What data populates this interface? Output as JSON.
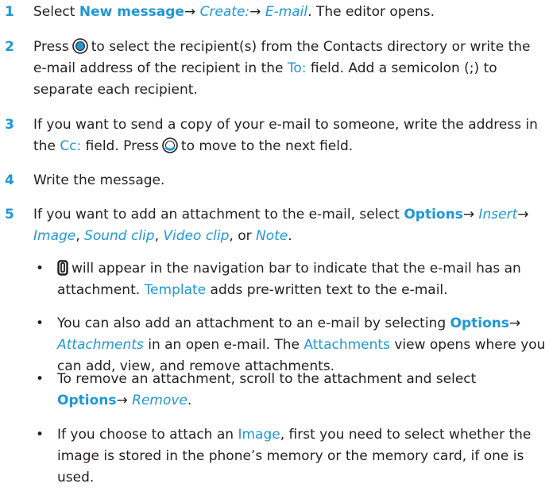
{
  "steps": [
    {
      "number": "1",
      "pre": "Select ",
      "new_message": "New message",
      "arrow1": "→ ",
      "create": "Create:",
      "arrow2": "→ ",
      "email": "E-mail",
      "post": ". The editor opens."
    },
    {
      "number": "2",
      "pre": "Press",
      "mid": "to select the recipient(s) from the Contacts directory or write the e-mail address of the recipient in the ",
      "to_field": "To:",
      "post": " field. Add a semicolon (;) to separate each recipient."
    },
    {
      "number": "3",
      "pre": "If you want to send a copy of your e-mail to someone, write the address in the ",
      "cc_field": "Cc:",
      "mid": " field. Press",
      "post": "to move to the next field."
    },
    {
      "number": "4",
      "text": "Write the message."
    },
    {
      "number": "5",
      "pre": "If you want to add an attachment to the e-mail, select ",
      "options": "Options",
      "arrow": "→ ",
      "insert": "Insert",
      "arrow2": "→ ",
      "image": "Image",
      "sep1": ", ",
      "sound_clip": "Sound clip",
      "sep2": ", ",
      "video_clip": "Video clip",
      "sep3": ", or ",
      "note": "Note",
      "post": "."
    }
  ],
  "bullets": [
    {
      "dot": "•",
      "mid": "will appear in the navigation bar to indicate that the e-mail has an attachment. ",
      "template": "Template",
      "post": " adds pre-written text to the e-mail."
    },
    {
      "dot": "•",
      "pre": "You can also add an attachment to an e-mail by selecting ",
      "options": "Options",
      "arrow": "→ ",
      "attachments_cmd": "Attachments",
      "mid": " in an open e-mail. The ",
      "attachments_view": "Attachments",
      "post": " view opens where you can add, view, and remove attachments."
    },
    {
      "dot": "•",
      "pre": "To remove an attachment, scroll to the attachment and select ",
      "options": "Options",
      "arrow": "→ ",
      "remove": "Remove",
      "post": "."
    },
    {
      "dot": "•",
      "pre": "If you choose to attach an ",
      "image": "Image",
      "post": ", first you need to select whether the image is stored in the phone’s memory or the memory card, if one is used."
    }
  ],
  "colors": {
    "accent": "#1f97d4",
    "text": "#231f20"
  },
  "icons": {
    "select_key": "joystick-press-icon",
    "nav_key": "joystick-down-icon",
    "attachment": "paperclip-icon"
  }
}
